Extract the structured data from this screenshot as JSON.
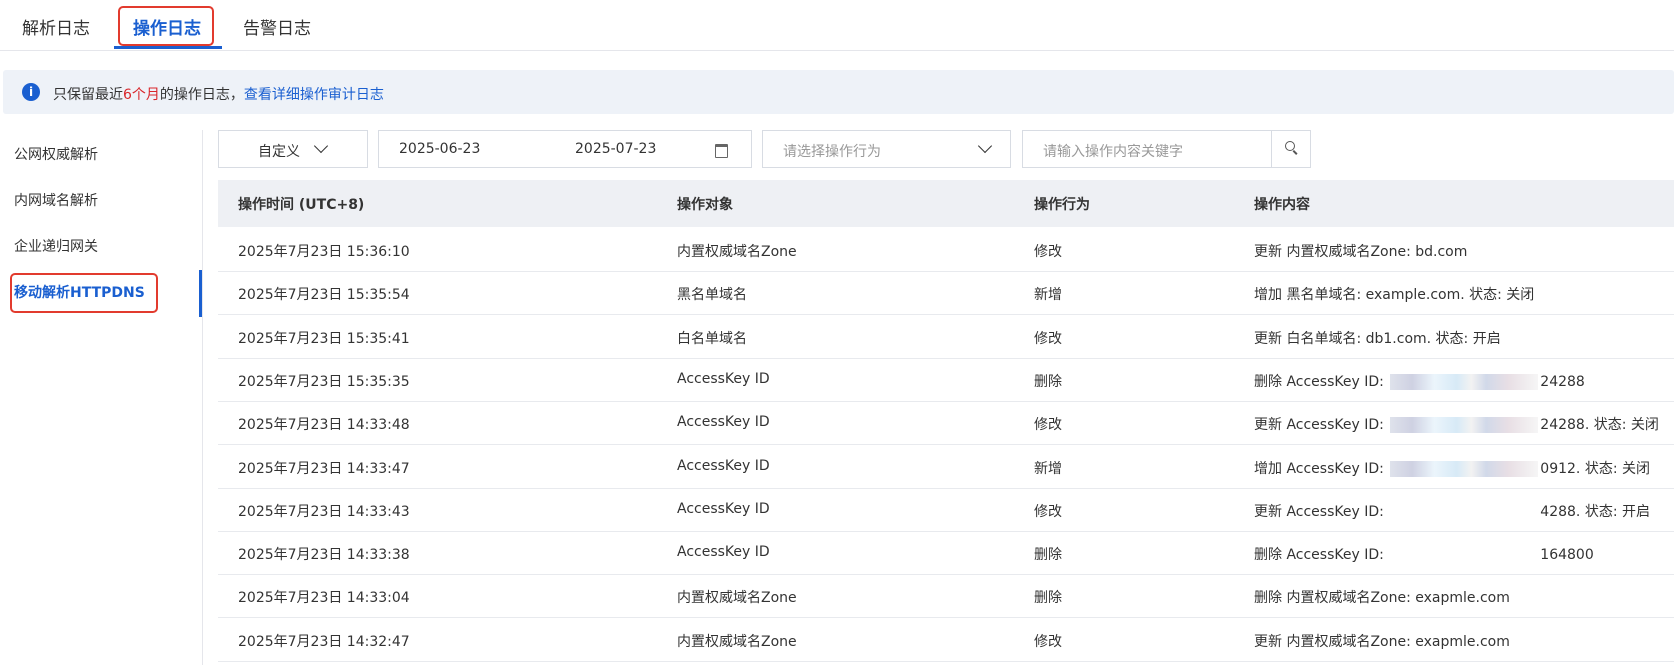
{
  "tabs": [
    {
      "label": "解析日志"
    },
    {
      "label": "操作日志"
    },
    {
      "label": "告警日志"
    }
  ],
  "notice": {
    "prefix": "只保留最近",
    "highlight": "6个月",
    "suffix": "的操作日志，",
    "link": "查看详细操作审计日志"
  },
  "sidebar": {
    "items": [
      {
        "label": "公网权威解析"
      },
      {
        "label": "内网域名解析"
      },
      {
        "label": "企业递归网关"
      },
      {
        "label": "移动解析HTTPDNS"
      }
    ]
  },
  "filters": {
    "range_select": "自定义",
    "date_start": "2025-06-23",
    "date_end": "2025-07-23",
    "action_placeholder": "请选择操作行为",
    "keyword_placeholder": "请输入操作内容关键字"
  },
  "table": {
    "columns": [
      "操作时间 (UTC+8)",
      "操作对象",
      "操作行为",
      "操作内容"
    ],
    "rows": [
      {
        "time": "2025年7月23日 15:36:10",
        "object": "内置权威域名Zone",
        "action": "修改",
        "content_pre": "更新 内置权威域名Zone: bd.com",
        "content_post": ""
      },
      {
        "time": "2025年7月23日 15:35:54",
        "object": "黑名单域名",
        "action": "新增",
        "content_pre": "增加 黑名单域名: example.com. 状态: 关闭",
        "content_post": ""
      },
      {
        "time": "2025年7月23日 15:35:41",
        "object": "白名单域名",
        "action": "修改",
        "content_pre": "更新 白名单域名: db1.com. 状态: 开启",
        "content_post": ""
      },
      {
        "time": "2025年7月23日 15:35:35",
        "object": "AccessKey ID",
        "action": "删除",
        "content_pre": "删除 AccessKey ID: ",
        "content_post": "24288"
      },
      {
        "time": "2025年7月23日 14:33:48",
        "object": "AccessKey ID",
        "action": "修改",
        "content_pre": "更新 AccessKey ID: ",
        "content_post": "24288. 状态: 关闭"
      },
      {
        "time": "2025年7月23日 14:33:47",
        "object": "AccessKey ID",
        "action": "新增",
        "content_pre": "增加 AccessKey ID: ",
        "content_post": "0912. 状态: 关闭"
      },
      {
        "time": "2025年7月23日 14:33:43",
        "object": "AccessKey ID",
        "action": "修改",
        "content_pre": "更新 AccessKey ID: ",
        "content_post": "4288. 状态: 开启"
      },
      {
        "time": "2025年7月23日 14:33:38",
        "object": "AccessKey ID",
        "action": "删除",
        "content_pre": "删除 AccessKey ID: ",
        "content_post": "164800"
      },
      {
        "time": "2025年7月23日 14:33:04",
        "object": "内置权威域名Zone",
        "action": "删除",
        "content_pre": "删除 内置权威域名Zone: exapmle.com",
        "content_post": ""
      },
      {
        "time": "2025年7月23日 14:32:47",
        "object": "内置权威域名Zone",
        "action": "修改",
        "content_pre": "更新 内置权威域名Zone: exapmle.com",
        "content_post": ""
      }
    ]
  },
  "colors": {
    "accent": "#1a5fd0",
    "highlight_red": "#d9262b",
    "annotation_red": "#e23b2e"
  }
}
